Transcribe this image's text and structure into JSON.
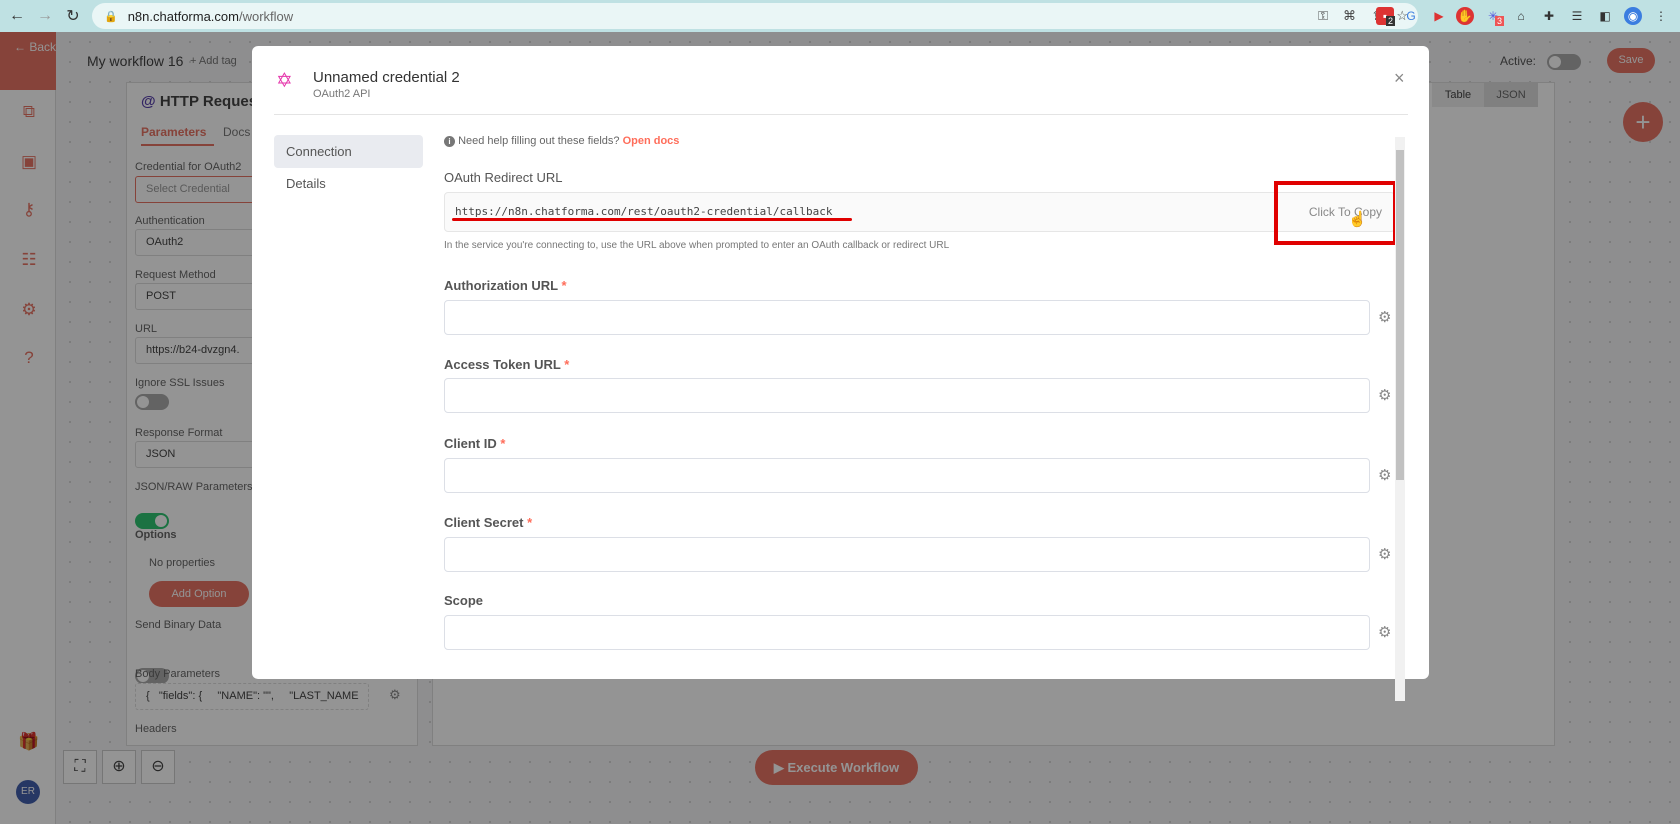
{
  "browser": {
    "url_host": "n8n.chatforma.com",
    "url_path": "/workflow",
    "badges": {
      "ext1": "2",
      "ext2": "3"
    }
  },
  "workflow": {
    "name": "My workflow 16",
    "add_tag": "+ Add tag",
    "active_label": "Active:",
    "save_label": "Save",
    "table_tab": "Table",
    "json_tab": "JSON",
    "execute_label": "Execute Workflow",
    "avatar": "ER",
    "back": "← Back"
  },
  "node_panel": {
    "title": "HTTP Request",
    "tabs": [
      "Parameters",
      "Docs"
    ],
    "credential_label": "Credential for OAuth2",
    "credential_placeholder": "Select Credential",
    "auth_label": "Authentication",
    "auth_value": "OAuth2",
    "method_label": "Request Method",
    "method_value": "POST",
    "url_label": "URL",
    "url_value": "https://b24-dvzgn4.",
    "ssl_label": "Ignore SSL Issues",
    "response_label": "Response Format",
    "response_value": "JSON",
    "jsonraw_label": "JSON/RAW Parameters",
    "options_label": "Options",
    "no_props": "No properties",
    "add_option": "Add Option",
    "binary_label": "Send Binary Data",
    "body_label": "Body Parameters",
    "body_value": "{   \"fields\": {     \"NAME\": \"\",     \"LAST_NAME",
    "headers_label": "Headers"
  },
  "modal": {
    "title": "Unnamed credential 2",
    "subtitle": "OAuth2 API",
    "nav": [
      "Connection",
      "Details"
    ],
    "help_text": "Need help filling out these fields?",
    "help_link": "Open docs",
    "redirect_label": "OAuth Redirect URL",
    "redirect_url": "https://n8n.chatforma.com/rest/oauth2-credential/callback",
    "copy_label": "Click To Copy",
    "redirect_hint": "In the service you're connecting to, use the URL above when prompted to enter an OAuth callback or redirect URL",
    "fields": [
      {
        "label": "Authorization URL",
        "required": "*",
        "value": ""
      },
      {
        "label": "Access Token URL",
        "required": "*",
        "value": ""
      },
      {
        "label": "Client ID",
        "required": "*",
        "value": ""
      },
      {
        "label": "Client Secret",
        "required": "*",
        "value": ""
      },
      {
        "label": "Scope",
        "required": "",
        "value": ""
      }
    ]
  },
  "colors": {
    "accent": "#ff6d5a",
    "annotation_red": "#e00000"
  }
}
